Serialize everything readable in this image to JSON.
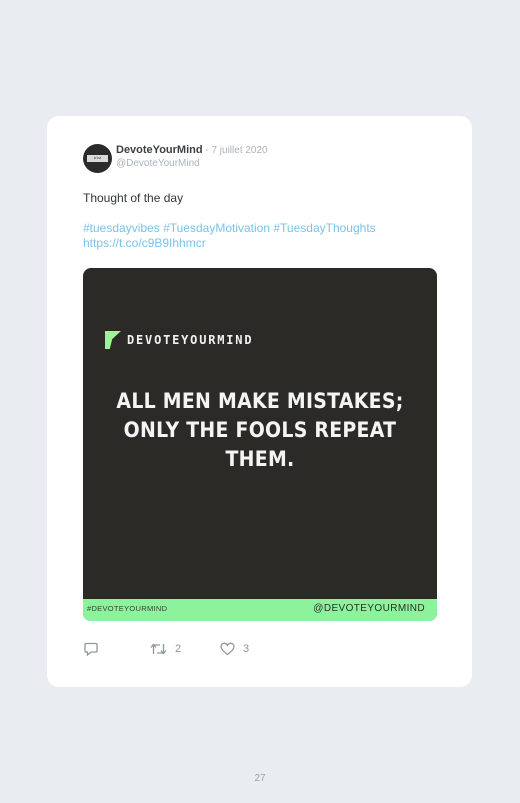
{
  "tweet": {
    "author_name": "DevoteYourMind",
    "date": " - 7 juillet 2020",
    "handle": "@DevoteYourMind",
    "text": "Thought of the day",
    "hashtags": [
      "#tuesdayvibes",
      "#TuesdayMotivation",
      "#TuesdayThoughts"
    ],
    "link": "https://t.co/c9B9Ihhmcr"
  },
  "media": {
    "brand_name": "DEVOTEYOURMIND",
    "quote": "ALL MEN MAKE MISTAKES; ONLY THE FOOLS REPEAT THEM.",
    "footer_left": "#DEVOTEYOURMIND",
    "footer_right": "@DEVOTEYOURMIND"
  },
  "actions": {
    "reply_count": "",
    "retweet_count": "2",
    "like_count": "3"
  },
  "page": {
    "number": "27"
  },
  "colors": {
    "background": "#e9ecf1",
    "link": "#7ac2e8",
    "media_bg": "#2b2a27",
    "accent_green": "#8cf39c"
  },
  "icons": [
    "avatar-logo",
    "reply-icon",
    "retweet-icon",
    "like-icon"
  ]
}
